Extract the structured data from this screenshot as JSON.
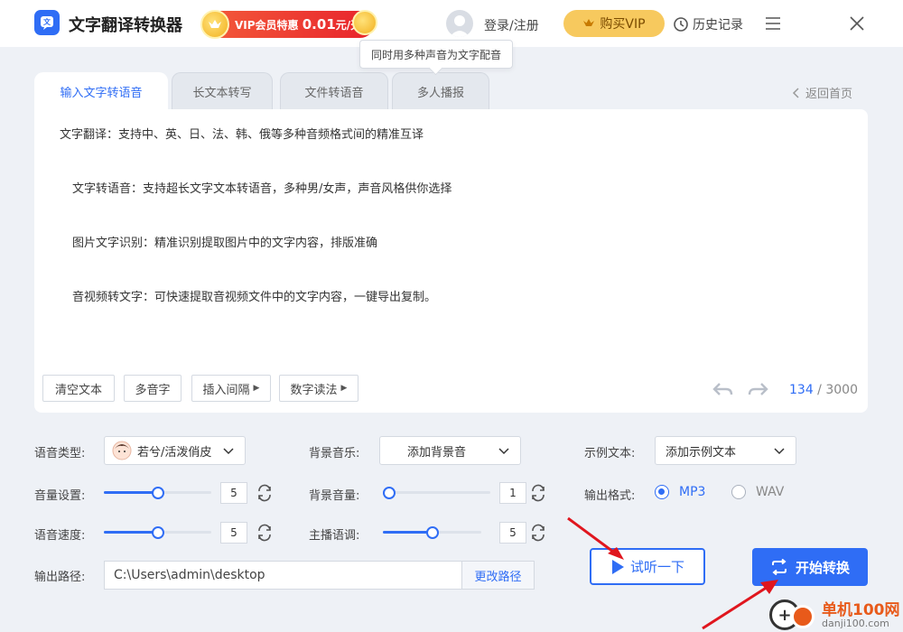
{
  "app": {
    "title": "文字翻译转换器",
    "vip_promo_prefix": "VIP会员特惠",
    "vip_promo_price": "0.01",
    "vip_promo_unit": "元/天",
    "login": "登录/注册",
    "buy_vip": "购买VIP",
    "history": "历史记录"
  },
  "tooltip": "同时用多种声音为文字配音",
  "tabs": [
    {
      "label": "输入文字转语音",
      "active": true
    },
    {
      "label": "长文本转写",
      "active": false
    },
    {
      "label": "文件转语音",
      "active": false
    },
    {
      "label": "多人播报",
      "active": false
    }
  ],
  "back_home": "返回首页",
  "editor": {
    "lines": [
      "文字翻译：支持中、英、日、法、韩、俄等多种音频格式间的精准互译",
      "文字转语音：支持超长文字文本转语音，多种男/女声，声音风格供你选择",
      "图片文字识别：精准识别提取图片中的文字内容，排版准确",
      "音视频转文字：可快速提取音视频文件中的文字内容，一键导出复制。"
    ],
    "tools": [
      "清空文本",
      "多音字",
      "插入间隔",
      "数字读法"
    ],
    "count_current": "134",
    "count_sep": " / ",
    "count_max": "3000"
  },
  "settings": {
    "voice_type_label": "语音类型:",
    "voice_type_value": "若兮/活泼俏皮",
    "bg_music_label": "背景音乐:",
    "bg_music_value": "添加背景音",
    "sample_text_label": "示例文本:",
    "sample_text_value": "添加示例文本",
    "volume_label": "音量设置:",
    "volume_value": "5",
    "volume_fraction": 0.5,
    "bg_volume_label": "背景音量:",
    "bg_volume_value": "1",
    "bg_volume_fraction": 0.0,
    "output_format_label": "输出格式:",
    "format_mp3": "MP3",
    "format_wav": "WAV",
    "format_selected": "MP3",
    "speed_label": "语音速度:",
    "speed_value": "5",
    "speed_fraction": 0.5,
    "pitch_label": "主播语调:",
    "pitch_value": "5",
    "pitch_fraction": 0.5,
    "output_path_label": "输出路径:",
    "output_path_value": "C:\\Users\\admin\\desktop",
    "change_path": "更改路径"
  },
  "actions": {
    "preview": "试听一下",
    "convert": "开始转换"
  },
  "watermark": {
    "name": "单机100网",
    "url": "danji100.com"
  },
  "colors": {
    "accent": "#2f6df5",
    "annotation_arrow": "#e0161e",
    "vip_gold": "#f7c95e"
  }
}
